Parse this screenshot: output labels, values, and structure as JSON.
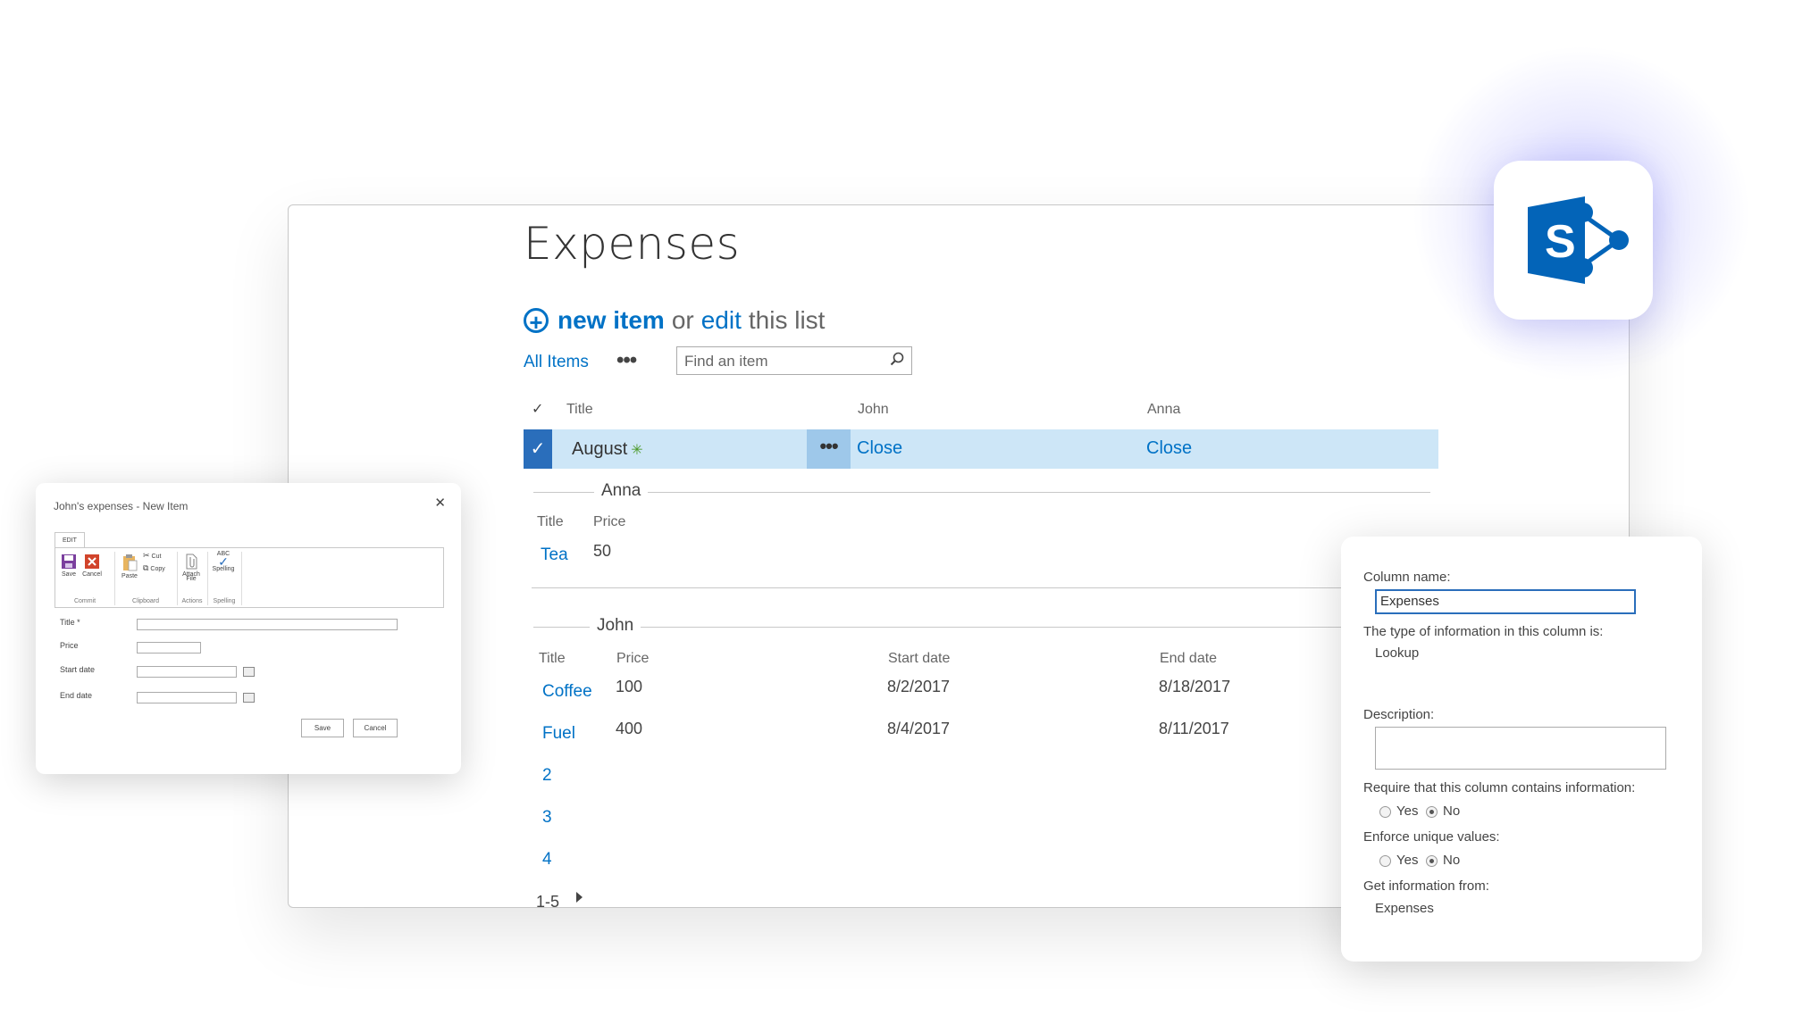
{
  "main": {
    "title": "Expenses",
    "command": {
      "new_item": "new item",
      "or": "or",
      "edit": "edit",
      "this_list": "this list"
    },
    "view": {
      "name": "All Items",
      "more": "•••"
    },
    "search": {
      "placeholder": "Find an item"
    },
    "columns": {
      "title": "Title",
      "john": "John",
      "anna": "Anna"
    },
    "selected_row": {
      "title": "August",
      "ellipsis": "•••",
      "john": "Close",
      "anna": "Close"
    },
    "anna_group": {
      "label": "Anna",
      "headers": {
        "title": "Title",
        "price": "Price"
      },
      "rows": [
        {
          "title": "Tea",
          "price": "50"
        }
      ]
    },
    "john_group": {
      "label": "John",
      "headers": {
        "title": "Title",
        "price": "Price",
        "start": "Start date",
        "end": "End date"
      },
      "rows": [
        {
          "title": "Coffee",
          "price": "100",
          "start": "8/2/2017",
          "end": "8/18/2017"
        },
        {
          "title": "Fuel",
          "price": "400",
          "start": "8/4/2017",
          "end": "8/11/2017"
        }
      ],
      "pages": [
        "2",
        "3",
        "4"
      ]
    },
    "pager": "1-5"
  },
  "dialog": {
    "title": "John's expenses - New Item",
    "ribbon_tab": "EDIT",
    "buttons": {
      "save": "Save",
      "cancel": "Cancel",
      "paste": "Paste",
      "cut": "Cut",
      "copy": "Copy",
      "attach_line1": "Attach",
      "attach_line2": "File",
      "spelling_top": "ABC",
      "spelling": "Spelling"
    },
    "groups": {
      "commit": "Commit",
      "clipboard": "Clipboard",
      "actions": "Actions",
      "spelling": "Spelling"
    },
    "fields": {
      "title": "Title *",
      "price": "Price",
      "start": "Start date",
      "end": "End date"
    },
    "save_button": "Save",
    "cancel_button": "Cancel"
  },
  "column_panel": {
    "column_name_label": "Column name:",
    "column_name_value": "Expenses",
    "type_label": "The type of information in this column is:",
    "type_value": "Lookup",
    "description_label": "Description:",
    "require_label": "Require that this column contains information:",
    "unique_label": "Enforce unique values:",
    "yes": "Yes",
    "no": "No",
    "require_selected": "No",
    "unique_selected": "No",
    "source_label": "Get information from:",
    "source_value": "Expenses"
  },
  "colors": {
    "accent": "#0072c6",
    "selected_row": "#cde6f7",
    "check_fill": "#2a6ebb",
    "logo": "#0364b8"
  }
}
